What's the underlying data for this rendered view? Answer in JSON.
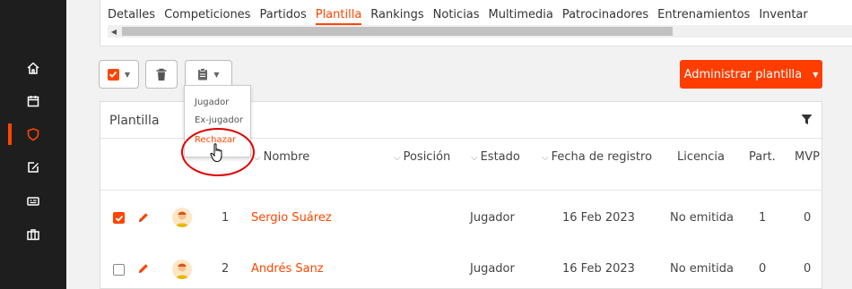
{
  "sidebar": {
    "items": [
      {
        "icon": "home-icon"
      },
      {
        "icon": "calendar-icon"
      },
      {
        "icon": "shield-icon",
        "active": true
      },
      {
        "icon": "edit-icon"
      },
      {
        "icon": "id-card-icon"
      },
      {
        "icon": "briefcase-icon"
      }
    ]
  },
  "tabs": [
    "Detalles",
    "Competiciones",
    "Partidos",
    "Plantilla",
    "Rankings",
    "Noticias",
    "Multimedia",
    "Patrocinadores",
    "Entrenamientos",
    "Inventar"
  ],
  "active_tab": "Plantilla",
  "toolbar": {
    "primary_label": "Administrar plantilla"
  },
  "dropdown": {
    "items": [
      "Jugador",
      "Ex-jugador",
      "Rechazar"
    ],
    "hover": "Rechazar"
  },
  "panel": {
    "title": "Plantilla",
    "columns": [
      "Nombre",
      "Posición",
      "Estado",
      "Fecha de registro",
      "Licencia",
      "Part.",
      "MVP"
    ]
  },
  "rows": [
    {
      "checked": true,
      "number": "1",
      "name": "Sergio Suárez",
      "estado": "Jugador",
      "fecha": "16 Feb 2023",
      "licencia": "No emitida",
      "part": "1",
      "mvp": "0"
    },
    {
      "checked": false,
      "number": "2",
      "name": "Andrés Sanz",
      "estado": "Jugador",
      "fecha": "16 Feb 2023",
      "licencia": "No emitida",
      "part": "0",
      "mvp": "0"
    }
  ],
  "colors": {
    "accent": "#ff4500",
    "sidebar": "#1e1e1e"
  }
}
